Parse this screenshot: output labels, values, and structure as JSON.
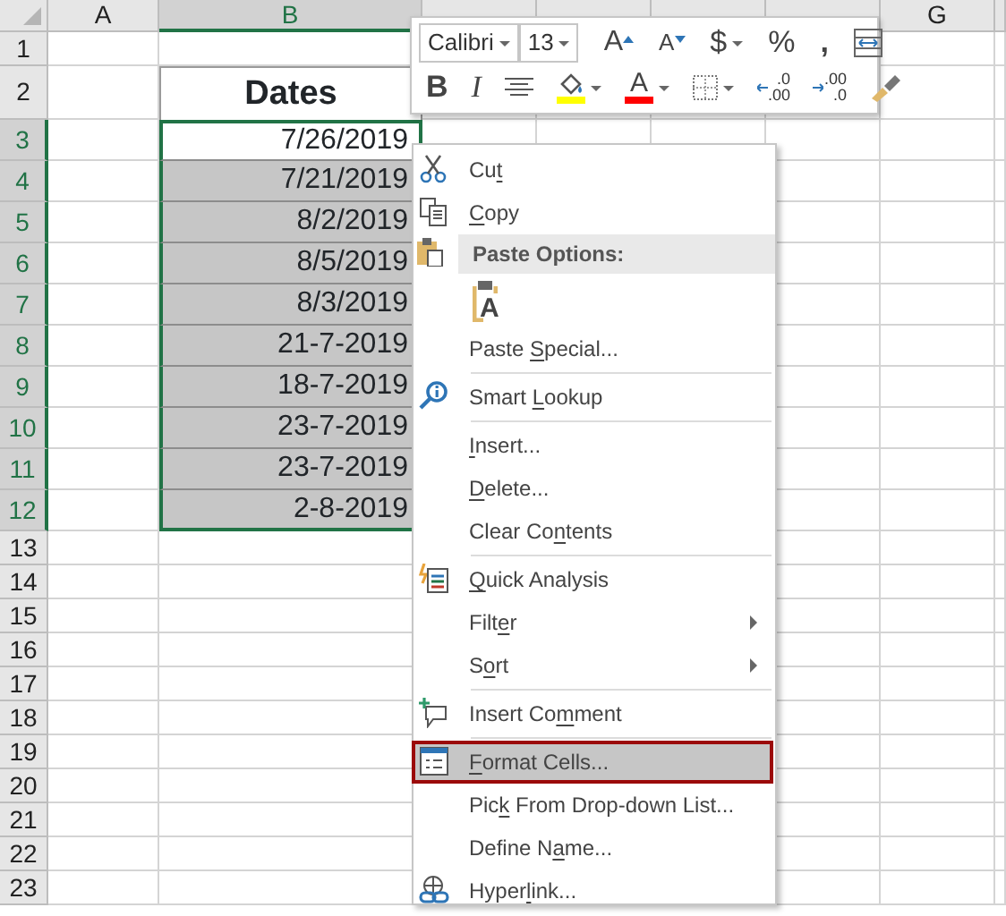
{
  "columns": [
    {
      "kind": "letter",
      "label": "A",
      "selected": false
    },
    {
      "kind": "letter",
      "label": "B",
      "selected": true
    },
    {
      "kind": "covered",
      "selected": false
    },
    {
      "kind": "covered",
      "selected": false
    },
    {
      "kind": "covered",
      "selected": false
    },
    {
      "kind": "covered",
      "selected": false
    },
    {
      "kind": "letter",
      "label": "G",
      "selected": false
    }
  ],
  "rows": [
    {
      "label": "1",
      "selected": false
    },
    {
      "label": "2",
      "selected": false
    },
    {
      "label": "3",
      "selected": true
    },
    {
      "label": "4",
      "selected": true
    },
    {
      "label": "5",
      "selected": true
    },
    {
      "label": "6",
      "selected": true
    },
    {
      "label": "7",
      "selected": true
    },
    {
      "label": "8",
      "selected": true
    },
    {
      "label": "9",
      "selected": true
    },
    {
      "label": "10",
      "selected": true
    },
    {
      "label": "11",
      "selected": true
    },
    {
      "label": "12",
      "selected": true
    },
    {
      "label": "13",
      "selected": false
    },
    {
      "label": "14",
      "selected": false
    },
    {
      "label": "15",
      "selected": false
    },
    {
      "label": "16",
      "selected": false
    },
    {
      "label": "17",
      "selected": false
    },
    {
      "label": "18",
      "selected": false
    },
    {
      "label": "19",
      "selected": false
    },
    {
      "label": "20",
      "selected": false
    },
    {
      "label": "21",
      "selected": false
    },
    {
      "label": "22",
      "selected": false
    },
    {
      "label": "23",
      "selected": false
    }
  ],
  "table": {
    "header": "Dates",
    "dates": [
      {
        "value": "7/26/2019",
        "active": true
      },
      {
        "value": "7/21/2019",
        "active": false
      },
      {
        "value": "8/2/2019",
        "active": false
      },
      {
        "value": "8/5/2019",
        "active": false
      },
      {
        "value": "8/3/2019",
        "active": false
      },
      {
        "value": "21-7-2019",
        "active": false
      },
      {
        "value": "18-7-2019",
        "active": false
      },
      {
        "value": "23-7-2019",
        "active": false
      },
      {
        "value": "23-7-2019",
        "active": false
      },
      {
        "value": "2-8-2019",
        "active": false
      }
    ]
  },
  "mini_toolbar": {
    "font": "Calibri",
    "size": "13",
    "row1": [
      {
        "kind": "grow",
        "text": "A"
      },
      {
        "kind": "shrink",
        "text": "A"
      },
      {
        "kind": "currency",
        "text": "$",
        "dropdown": true
      },
      {
        "kind": "percent",
        "text": "%"
      },
      {
        "kind": "comma",
        "text": ","
      },
      {
        "kind": "wrap"
      }
    ],
    "row2": [
      {
        "kind": "bold",
        "text": "B"
      },
      {
        "kind": "italic",
        "text": "I"
      },
      {
        "kind": "align"
      },
      {
        "kind": "fill",
        "color": "#ffff00",
        "dropdown": true
      },
      {
        "kind": "fontcolor",
        "text": "A",
        "color": "#ff0000",
        "dropdown": true
      },
      {
        "kind": "borders",
        "dropdown": true
      },
      {
        "kind": "incdec",
        "text": ".0",
        "text2": ".00"
      },
      {
        "kind": "decdec",
        "text": ".00",
        "text2": ".0"
      },
      {
        "kind": "painter"
      }
    ]
  },
  "context_menu": [
    {
      "kind": "item",
      "pre": "Cu",
      "key": "t"
    },
    {
      "kind": "item",
      "key": "C",
      "post": "opy"
    },
    {
      "kind": "header",
      "text": "Paste Options:"
    },
    {
      "kind": "paste-buttons",
      "buttons": [
        {
          "text": "A"
        }
      ]
    },
    {
      "kind": "item",
      "pre": "Paste ",
      "key": "S",
      "post": "pecial..."
    },
    {
      "kind": "item",
      "pre": "Smart ",
      "key": "L",
      "post": "ookup",
      "separator_before": true
    },
    {
      "kind": "item",
      "key": "I",
      "post": "nsert...",
      "separator_before": true
    },
    {
      "kind": "item",
      "key": "D",
      "post": "elete..."
    },
    {
      "kind": "item",
      "pre": "Clear Co",
      "key": "n",
      "post": "tents"
    },
    {
      "kind": "item",
      "key": "Q",
      "post": "uick Analysis",
      "separator_before": true
    },
    {
      "kind": "item",
      "pre": "Filt",
      "key": "e",
      "post": "r",
      "submenu": true
    },
    {
      "kind": "item",
      "pre": "S",
      "key": "o",
      "post": "rt",
      "submenu": true
    },
    {
      "kind": "item",
      "pre": "Insert Co",
      "key": "m",
      "post": "ment",
      "separator_before": true
    },
    {
      "kind": "item",
      "key": "F",
      "post": "ormat Cells...",
      "separator_before": true,
      "highlighted": true
    },
    {
      "kind": "item",
      "pre": "Pic",
      "key": "k",
      "post": " From Drop-down List..."
    },
    {
      "kind": "item",
      "pre": "Define N",
      "key": "a",
      "post": "me..."
    },
    {
      "kind": "item",
      "pre": "Hyper",
      "key": "l",
      "post": "ink..."
    }
  ]
}
